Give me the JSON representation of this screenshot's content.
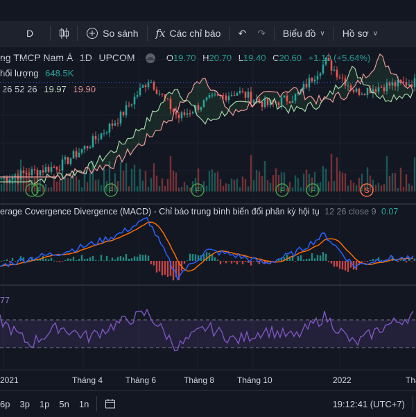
{
  "toolbar": {
    "interval": "D",
    "compare_label": "So sánh",
    "indicators_label": "Các chỉ báo",
    "chart_type_label": "Biểu đồ",
    "profile_label": "Hồ sơ"
  },
  "legend": {
    "symbol": "ng TMCP Nam Á",
    "interval": "1D",
    "exchange": "UPCOM",
    "o_label": "O",
    "o": "19.70",
    "h_label": "H",
    "h": "20.70",
    "l_label": "L",
    "l": "19.40",
    "c_label": "C",
    "c": "20.60",
    "change": "+1.10 (+5.64%)",
    "volume_label": "hối lượng",
    "volume": "648.5K",
    "ichimoku_params": "26 52 26",
    "ichimoku_v1": "19.97",
    "ichimoku_v2": "19.90"
  },
  "macd_label": {
    "title": "erage Covergence Divergence (MACD) - Chỉ báo trung bình biến đổi phân kỳ hội tụ",
    "params": "12 26 close 9",
    "value": "0.07"
  },
  "rsi_label": {
    "value": "77"
  },
  "xaxis": {
    "labels": [
      "2021",
      "Tháng 4",
      "Tháng 6",
      "Tháng 8",
      "Tháng 10",
      "2022",
      "Thá"
    ]
  },
  "bottom": {
    "ranges": [
      "6p",
      "3p",
      "1p",
      "5n",
      "1n"
    ],
    "time": "19:12:41 (UTC+7)"
  },
  "colors": {
    "up": "#26a69a",
    "down": "#ef5350",
    "macd": "#2962ff",
    "signal": "#ff6d00",
    "rsi": "#7e57c2"
  },
  "chart_data": {
    "type": "line",
    "price": {
      "x": [
        "2021-01",
        "2021-02",
        "2021-03",
        "2021-04",
        "2021-05",
        "2021-06",
        "2021-07",
        "2021-08",
        "2021-09",
        "2021-10",
        "2021-11",
        "2021-12",
        "2022-01",
        "2022-02",
        "2022-03"
      ],
      "close": [
        9.5,
        10.2,
        11.0,
        13.5,
        16.5,
        21.0,
        16.5,
        18.5,
        19.5,
        18.0,
        19.0,
        23.0,
        19.5,
        20.2,
        20.6
      ]
    },
    "macd": {
      "macd": [
        -0.2,
        0.1,
        0.3,
        0.6,
        1.0,
        1.6,
        -0.6,
        0.4,
        0.2,
        -0.1,
        0.3,
        1.0,
        -0.2,
        0.1,
        0.07
      ]
    },
    "rsi": {
      "values": [
        70,
        35,
        60,
        45,
        65,
        80,
        30,
        60,
        40,
        55,
        45,
        75,
        35,
        60,
        77
      ]
    },
    "markers": [
      "F",
      "F",
      "F",
      "F",
      "F",
      "S",
      "F"
    ]
  }
}
